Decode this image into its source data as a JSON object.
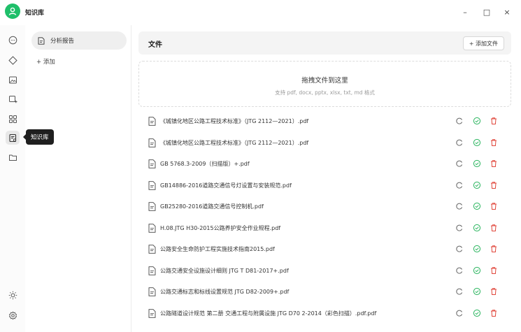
{
  "app": {
    "title": "知识库"
  },
  "window_controls": {
    "minimize": "–",
    "maximize": "□",
    "close": "×"
  },
  "rail": {
    "tooltip": "知识库",
    "icons": [
      "chat-icon",
      "sparkle-icon",
      "image-icon",
      "image-edit-icon",
      "apps-grid-icon",
      "knowledge-base-icon",
      "folder-icon",
      "sun-icon",
      "settings-icon"
    ]
  },
  "sidebar": {
    "kb_item_label": "分析报告",
    "add_label": "+ 添加"
  },
  "main": {
    "title": "文件",
    "add_file_label": "+ 添加文件",
    "dropzone_title": "拖拽文件到这里",
    "dropzone_subtitle": "支持 pdf, docx, pptx, xlsx, txt, md 格式"
  },
  "files": [
    "《城镇化地区公路工程技术标准》（JTG 2112—2021）.pdf",
    "《城镇化地区公路工程技术标准》（JTG 2112—2021）.pdf",
    "GB 5768.3-2009（扫描版）+.pdf",
    "GB14886-2016道路交通信号灯设置与安装规范.pdf",
    "GB25280-2016道路交通信号控制机.pdf",
    "H.08.JTG H30-2015公路养护安全作业规程.pdf",
    "公路安全生命防护工程实施技术指南2015.pdf",
    "公路交通安全设施设计细则 JTG T D81-2017+.pdf",
    "公路交通标志和标线设置规范 JTG D82-2009+.pdf",
    "公路隧道设计规范 第二册 交通工程与附属设施 JTG D70 2-2014（彩色扫描）.pdf.pdf"
  ],
  "colors": {
    "accent": "#1fbf6a",
    "check": "#2bb55f",
    "delete": "#e0453a"
  }
}
